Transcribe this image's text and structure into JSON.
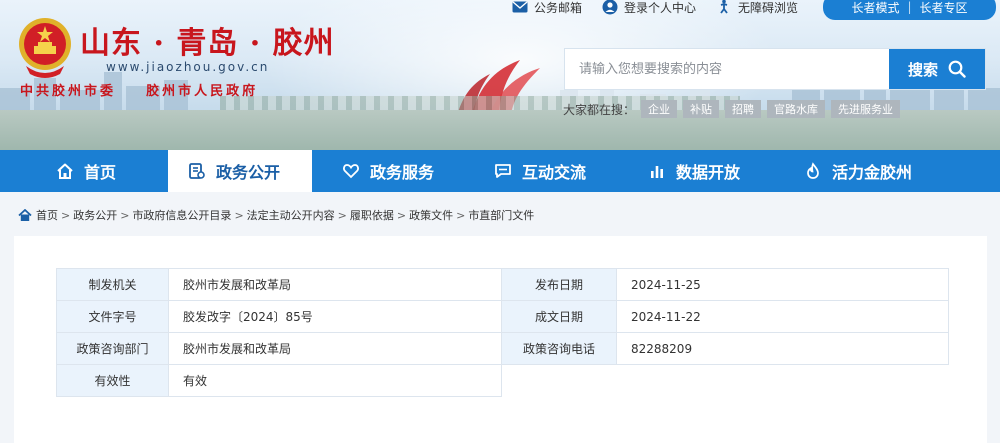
{
  "header": {
    "title": "山东 · 青岛 · 胶州",
    "url": "www.jiaozhou.gov.cn",
    "subtitle": "中共胶州市委    胶州市人民政府",
    "top_links": [
      {
        "label": "公务邮箱",
        "icon": "mail-icon"
      },
      {
        "label": "登录个人中心",
        "icon": "user-icon"
      },
      {
        "label": "无障碍浏览",
        "icon": "accessibility-icon"
      }
    ],
    "elder_mode": "长者模式",
    "elder_zone": "长者专区",
    "search": {
      "placeholder": "请输入您想要搜索的内容",
      "button": "搜索"
    },
    "hot_label": "大家都在搜：",
    "hot_words": [
      "企业",
      "补贴",
      "招聘",
      "官路水库",
      "先进服务业"
    ]
  },
  "nav": {
    "items": [
      {
        "label": "首页",
        "icon": "home-icon"
      },
      {
        "label": "政务公开",
        "icon": "document-icon",
        "active": true
      },
      {
        "label": "政务服务",
        "icon": "heart-icon"
      },
      {
        "label": "互动交流",
        "icon": "chat-icon"
      },
      {
        "label": "数据开放",
        "icon": "bar-chart-icon"
      },
      {
        "label": "活力金胶州",
        "icon": "flame-icon"
      }
    ]
  },
  "breadcrumb": [
    "首页",
    "政务公开",
    "市政府信息公开目录",
    "法定主动公开内容",
    "履职依据",
    "政策文件",
    "市直部门文件"
  ],
  "doc_info": {
    "issuer_label": "制发机关",
    "issuer": "胶州市发展和改革局",
    "publish_date_label": "发布日期",
    "publish_date": "2024-11-25",
    "doc_no_label": "文件字号",
    "doc_no": "胶发改字〔2024〕85号",
    "created_date_label": "成文日期",
    "created_date": "2024-11-22",
    "consult_dept_label": "政策咨询部门",
    "consult_dept": "胶州市发展和改革局",
    "consult_phone_label": "政策咨询电话",
    "consult_phone": "82288209",
    "validity_label": "有效性",
    "validity": "有效"
  },
  "colors": {
    "primary": "#1b7fd3",
    "brand_red": "#c8161d",
    "label_bg": "#eaf3fc"
  }
}
